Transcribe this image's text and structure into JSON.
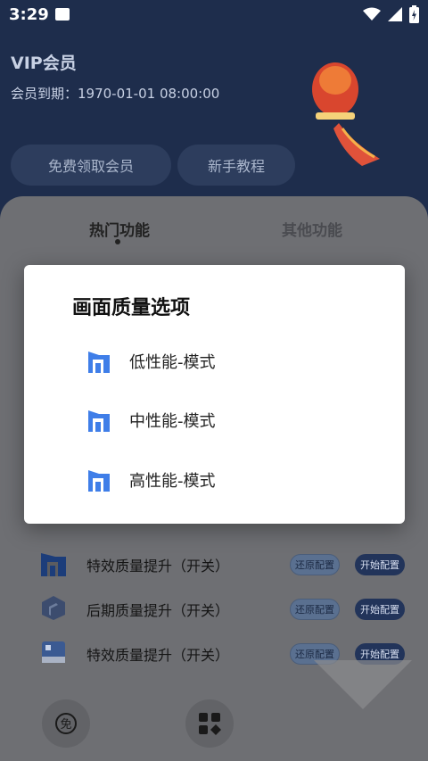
{
  "status_bar": {
    "time": "3:29"
  },
  "header": {
    "title": "VIP会员",
    "expire": "会员到期：1970-01-01 08:00:00",
    "free_vip_button": "免费领取会员",
    "guide_button": "新手教程"
  },
  "tabs": [
    {
      "label": "热门功能"
    },
    {
      "label": "其他功能"
    }
  ],
  "rows": [
    {
      "label": "特效质量提升（开关）",
      "restore": "还原配置",
      "start": "开始配置"
    },
    {
      "label": "后期质量提升（开关）",
      "restore": "还原配置",
      "start": "开始配置"
    },
    {
      "label": "特效质量提升（开关）",
      "restore": "还原配置",
      "start": "开始配置"
    }
  ],
  "dialog": {
    "title": "画面质量选项",
    "options": [
      {
        "label": "低性能-模式"
      },
      {
        "label": "中性能-模式"
      },
      {
        "label": "高性能-模式"
      }
    ]
  },
  "bottom_nav": {
    "left_icon_text": "免"
  },
  "colors": {
    "accent": "#3f7ee8",
    "header_bg": "#1e2d4c"
  }
}
